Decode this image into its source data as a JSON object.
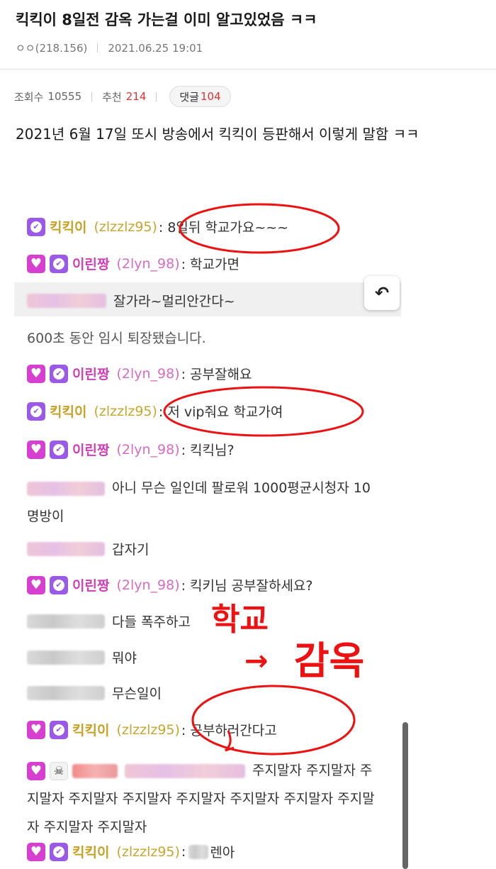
{
  "post": {
    "title": "킥킥이 8일전 감옥 가는걸 이미 알고있었음 ㅋㅋ",
    "author": "ㅇㅇ(218.156)",
    "datetime": "2021.06.25 19:01"
  },
  "stats": {
    "views_label": "조회수",
    "views": "10555",
    "recommend_label": "추천",
    "recommend": "214",
    "comments_label": "댓글",
    "comments": "104"
  },
  "body": {
    "text": "2021년 6월 17일 또시 방송에서 킥킥이 등판해서 이렇게 말함 ㅋㅋ"
  },
  "chat": {
    "streamer_nick": "킥킥이",
    "streamer_id": "(zlzzlz95)",
    "pink_nick": "이린짱",
    "pink_id": "(2lyn_98)",
    "messages": [
      ": 8일뒤 학교가요~~~",
      ": 학교가면",
      "잘가라~멀리안간다~",
      "600초 동안 임시 퇴장됐습니다.",
      ": 공부잘해요",
      ": 저 vip줘요 학교가여",
      ": 킥킥님?",
      "아니 무슨 일인데 팔로워 1000평균시청자 10명방이",
      "갑자기",
      ": 킥키님 공부잘하세요?",
      "다들 폭주하고",
      "뭐야",
      "무슨일이",
      ": 공부하러간다고",
      "주지말자 주지말자 주지말자 주지말자 주지말자 주지말자 주지말자 주지말자 주지말자 주지말자 주지말자",
      "렌아"
    ]
  },
  "annotation": {
    "handwritten_1": "학교",
    "arrow": "→",
    "handwritten_2": "감옥"
  },
  "icons": {
    "undo": "undo-arrow-icon",
    "heart_badge": "heart-badge-icon",
    "check_badge": "verified-badge-icon",
    "spider_badge": "spider-badge-icon"
  },
  "colors": {
    "streamer": "#c8a023",
    "pink": "#d13fb8",
    "recommend_red": "#dd3333",
    "annotation_red": "#ee1111"
  }
}
